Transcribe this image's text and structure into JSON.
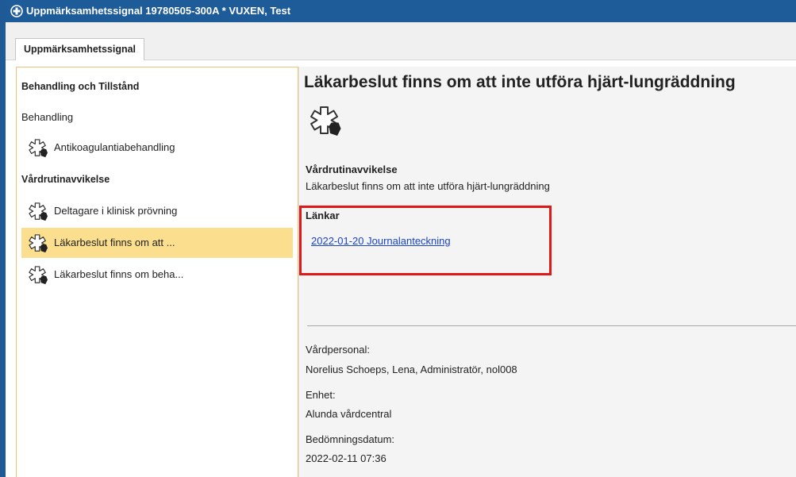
{
  "window": {
    "title": "Uppmärksamhetssignal 19780505-300A * VUXEN, Test"
  },
  "tabs": [
    {
      "label": "Uppmärksamhetssignal"
    }
  ],
  "sidebar": {
    "sections": [
      {
        "heading": "Behandling och Tillstånd",
        "subheading": "Behandling",
        "items": [
          {
            "label": "Antikoagulantiabehandling",
            "icon": "medical-star-icon"
          }
        ]
      },
      {
        "heading": "Vårdrutinavvikelse",
        "items": [
          {
            "label": "Deltagare i klinisk prövning",
            "icon": "medical-star-icon"
          },
          {
            "label": "Läkarbeslut finns om att ...",
            "icon": "medical-star-icon",
            "selected": true
          },
          {
            "label": "Läkarbeslut finns om beha...",
            "icon": "medical-star-icon"
          }
        ]
      }
    ]
  },
  "detail": {
    "title": "Läkarbeslut finns om att inte utföra hjärt-lungräddning",
    "category_label": "Vårdrutinavvikelse",
    "description": "Läkarbeslut finns om att inte utföra hjärt-lungräddning",
    "links_label": "Länkar",
    "links": [
      {
        "text": "2022-01-20 Journalanteckning"
      }
    ],
    "staff_label": "Vårdpersonal:",
    "staff_value": "Norelius Schoeps, Lena, Administratör, nol008",
    "unit_label": "Enhet:",
    "unit_value": "Alunda vårdcentral",
    "date_label": "Bedömningsdatum:",
    "date_value": "2022-02-11 07:36"
  },
  "colors": {
    "titlebar": "#1e5b99",
    "selected_row": "#fbdf8e",
    "panel_border": "#f3c27a",
    "link": "#1a44c9",
    "highlight": "#e01818"
  }
}
